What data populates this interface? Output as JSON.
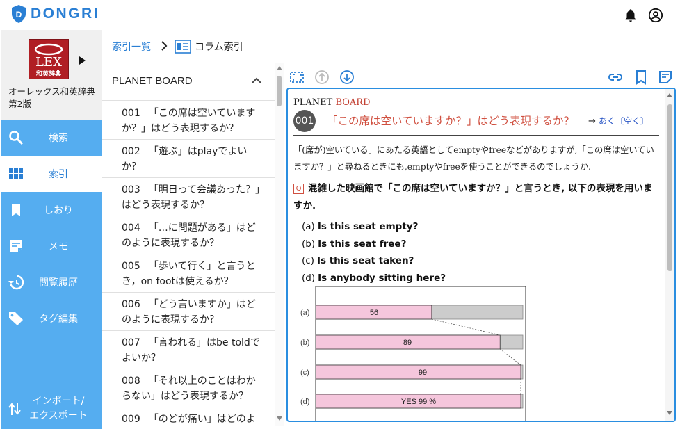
{
  "app": {
    "brand": "DONGRI",
    "brand_color": "#2a7fd4"
  },
  "book": {
    "title_line1": "オーレックス和英辞典",
    "title_line2": "第2版",
    "cover_text": "LEX",
    "cover_sub": "和英辞典"
  },
  "nav": [
    {
      "label": "検索",
      "icon": "search-icon"
    },
    {
      "label": "索引",
      "icon": "grid-icon",
      "active": true
    },
    {
      "label": "しおり",
      "icon": "bookmark-icon"
    },
    {
      "label": "メモ",
      "icon": "memo-icon"
    },
    {
      "label": "閲覧履歴",
      "icon": "history-icon"
    },
    {
      "label": "タグ編集",
      "icon": "tag-icon"
    }
  ],
  "import_export": {
    "line1": "インポート/",
    "line2": "エクスポート"
  },
  "breadcrumb": {
    "root": "索引一覧",
    "current": "コラム索引"
  },
  "list": {
    "header": "PLANET BOARD",
    "items": [
      {
        "num": "001",
        "text": "「この席は空いていますか？」はどう表現するか？"
      },
      {
        "num": "002",
        "text": "「遊ぶ」はplayでよいか？"
      },
      {
        "num": "003",
        "text": "「明日って会議あった？」はどう表現するか？"
      },
      {
        "num": "004",
        "text": "「…に問題がある」はどのように表現するか？"
      },
      {
        "num": "005",
        "text": "「歩いて行く」と言うとき，on footは使えるか？"
      },
      {
        "num": "006",
        "text": "「どう言いますか」はどのように表現するか？"
      },
      {
        "num": "007",
        "text": "「言われる」はbe toldでよいか？"
      },
      {
        "num": "008",
        "text": "「それ以上のことはわからない」はどう表現するか？"
      },
      {
        "num": "009",
        "text": "「のどが痛い」はどのように表現するか？"
      }
    ]
  },
  "content": {
    "section_label_a": "PLANET ",
    "section_label_b": "BOARD",
    "number": "001",
    "title": "「この席は空いていますか？」はどう表現するか？",
    "arrow": "→ ",
    "link": "あく〔空く〕",
    "intro": "「(席が)空いている」にあたる英語としてemptyやfreeなどがありますが,「この席は空いていますか？」と尋ねるときにも,emptyやfreeを使うことができるのでしょうか.",
    "qmark": "Q",
    "question": "混雑した映画館で「この席は空いていますか？」と言うとき, 以下の表現を用いますか.",
    "options": [
      {
        "label": "(a)",
        "text": "Is this seat empty?"
      },
      {
        "label": "(b)",
        "text": "Is this seat free?"
      },
      {
        "label": "(c)",
        "text": "Is this seat taken?"
      },
      {
        "label": "(d)",
        "text": "Is anybody sitting here?"
      }
    ]
  },
  "chart_data": {
    "type": "bar",
    "orientation": "horizontal",
    "stacked": true,
    "categories": [
      "(a)",
      "(b)",
      "(c)",
      "(d)"
    ],
    "values": [
      56,
      89,
      99,
      99
    ],
    "data_labels": [
      "56",
      "89",
      "99",
      "YES 99 %"
    ],
    "max": 100,
    "colors": {
      "yes": "#f5c6dc",
      "rest": "#cccccc",
      "border": "#333333"
    }
  }
}
